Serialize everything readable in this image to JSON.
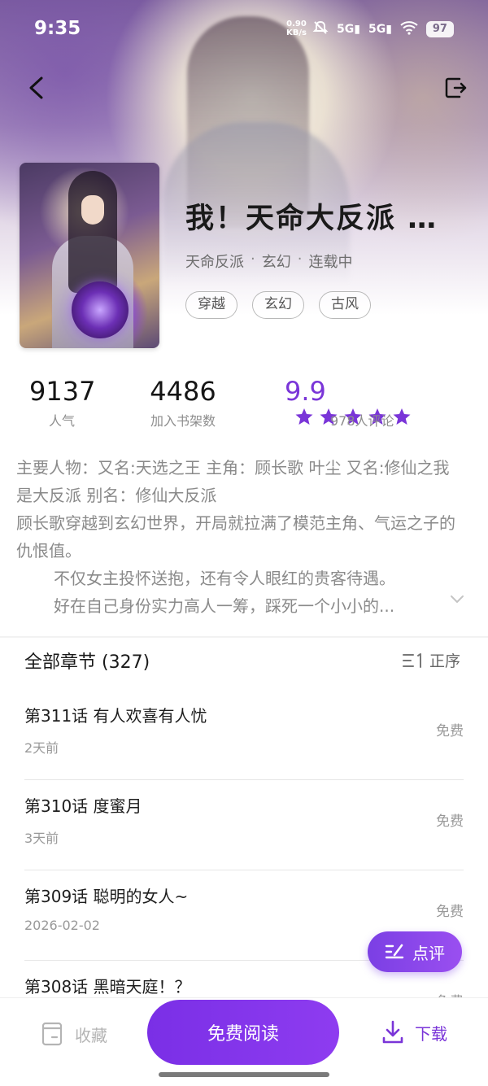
{
  "status_bar": {
    "time": "9:35",
    "net_speed_value": "0.90",
    "net_speed_unit": "KB/s",
    "signal1": "5G",
    "signal2": "5G",
    "battery": "97"
  },
  "book": {
    "title": "我！天命大反派 …",
    "author": "天命反派",
    "genre": "玄幻",
    "status": "连载中",
    "dot": "·",
    "tags": [
      "穿越",
      "玄幻",
      "古风"
    ]
  },
  "stats": {
    "popularity_value": "9137",
    "popularity_label": "人气",
    "shelf_value": "4486",
    "shelf_label": "加入书架数",
    "rating_score": "9.9",
    "rating_stars": 5,
    "rating_count": "978人评论"
  },
  "description": {
    "line1": "主要人物：又名:天选之王 主角：顾长歌 叶尘  又名:修仙之我是大反派  别名：修仙大反派",
    "line2": "顾长歌穿越到玄幻世界，开局就拉满了模范主角、气运之子的仇恨值。",
    "line3": "不仅女主投怀送抱，还有令人眼红的贵客待遇。",
    "line4": "好在自己身份实力高人一筹，踩死一个小小的..."
  },
  "chapters": {
    "header": "全部章节 (327)",
    "sort_label": "正序",
    "items": [
      {
        "title": "第311话 有人欢喜有人忧",
        "date": "2天前",
        "fee": "免费"
      },
      {
        "title": "第310话 度蜜月",
        "date": "3天前",
        "fee": "免费"
      },
      {
        "title": "第309话 聪明的女人~",
        "date": "2026-02-02",
        "fee": "免费"
      },
      {
        "title": "第308话 黑暗天庭！？",
        "date": "",
        "fee": "免费"
      }
    ]
  },
  "review_button": "点评",
  "bottom_bar": {
    "favorite": "收藏",
    "read": "免费阅读",
    "download": "下载"
  },
  "colors": {
    "accent": "#7a35d8",
    "muted": "#8d8d8d"
  }
}
